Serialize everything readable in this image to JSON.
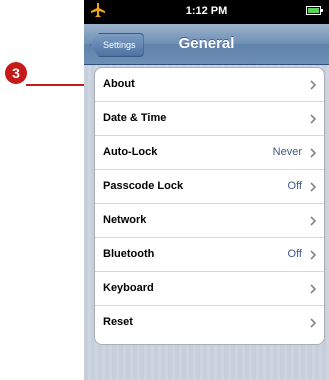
{
  "status_bar": {
    "time": "1:12 PM"
  },
  "nav": {
    "back_label": "Settings",
    "title": "General"
  },
  "rows": [
    {
      "label": "About",
      "value": ""
    },
    {
      "label": "Date & Time",
      "value": ""
    },
    {
      "label": "Auto-Lock",
      "value": "Never"
    },
    {
      "label": "Passcode Lock",
      "value": "Off"
    },
    {
      "label": "Network",
      "value": ""
    },
    {
      "label": "Bluetooth",
      "value": "Off"
    },
    {
      "label": "Keyboard",
      "value": ""
    },
    {
      "label": "Reset",
      "value": ""
    }
  ],
  "callout": {
    "number": "3",
    "color": "#c41a1a"
  },
  "icons": {
    "airplane": "airplane-icon",
    "battery": "battery-icon",
    "chevron": "chevron-right-icon"
  }
}
